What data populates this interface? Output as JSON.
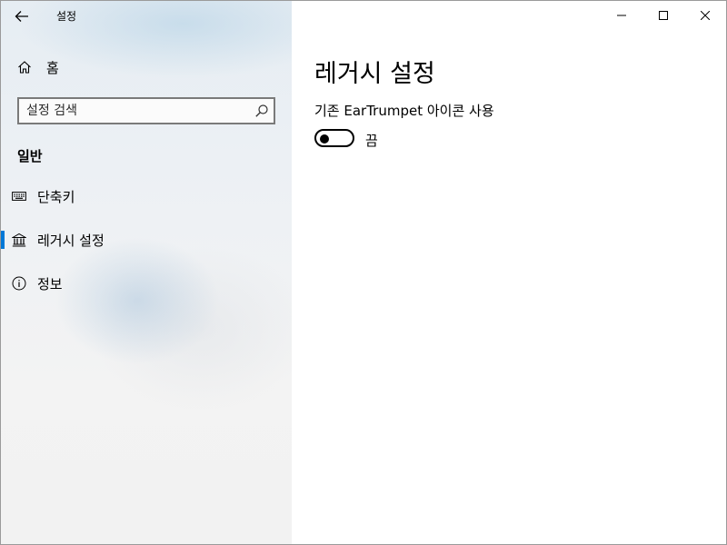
{
  "window": {
    "title": "설정",
    "controls": {
      "minimize_icon": "minimize-icon",
      "maximize_icon": "maximize-icon",
      "close_icon": "close-icon"
    }
  },
  "sidebar": {
    "back_icon": "back-arrow-icon",
    "home": {
      "label": "홈",
      "icon": "home-icon"
    },
    "search": {
      "placeholder": "설정 검색",
      "value": "",
      "icon": "search-icon"
    },
    "section_title": "일반",
    "items": [
      {
        "label": "단축키",
        "icon": "keyboard-icon",
        "selected": false
      },
      {
        "label": "레거시 설정",
        "icon": "bank-icon",
        "selected": true
      },
      {
        "label": "정보",
        "icon": "info-icon",
        "selected": false
      }
    ],
    "accent_color": "#0078d7"
  },
  "content": {
    "page_title": "레거시 설정",
    "settings": [
      {
        "label": "기존 EarTrumpet 아이콘 사용",
        "toggle_on": false,
        "state_text": "끔"
      }
    ]
  }
}
